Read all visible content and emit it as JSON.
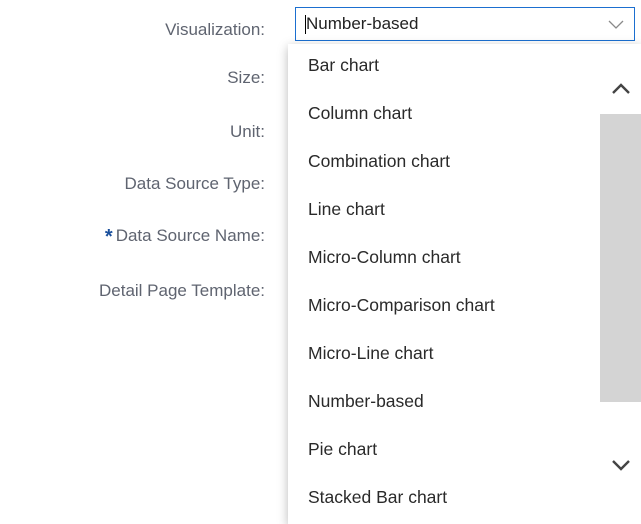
{
  "form": {
    "labels": {
      "visualization": "Visualization:",
      "size": "Size:",
      "unit": "Unit:",
      "data_source_type": "Data Source Type:",
      "data_source_name": "Data Source Name:",
      "detail_page_template": "Detail Page Template:"
    },
    "required_marker": "*",
    "visualization_value": "Number-based"
  },
  "dropdown": {
    "options": [
      "Bar chart",
      "Column chart",
      "Combination chart",
      "Line chart",
      "Micro-Column chart",
      "Micro-Comparison chart",
      "Micro-Line chart",
      "Number-based",
      "Pie chart",
      "Stacked Bar chart"
    ],
    "selected": "Number-based"
  },
  "icons": {
    "select_arrow": "chevron-down-icon",
    "scroll_up": "chevron-up-icon",
    "scroll_down": "chevron-down-icon"
  },
  "colors": {
    "focus_border": "#1b6fd0",
    "label_text": "#5f6470",
    "required_star": "#1a4f9c",
    "scroll_thumb": "#d4d4d4"
  }
}
